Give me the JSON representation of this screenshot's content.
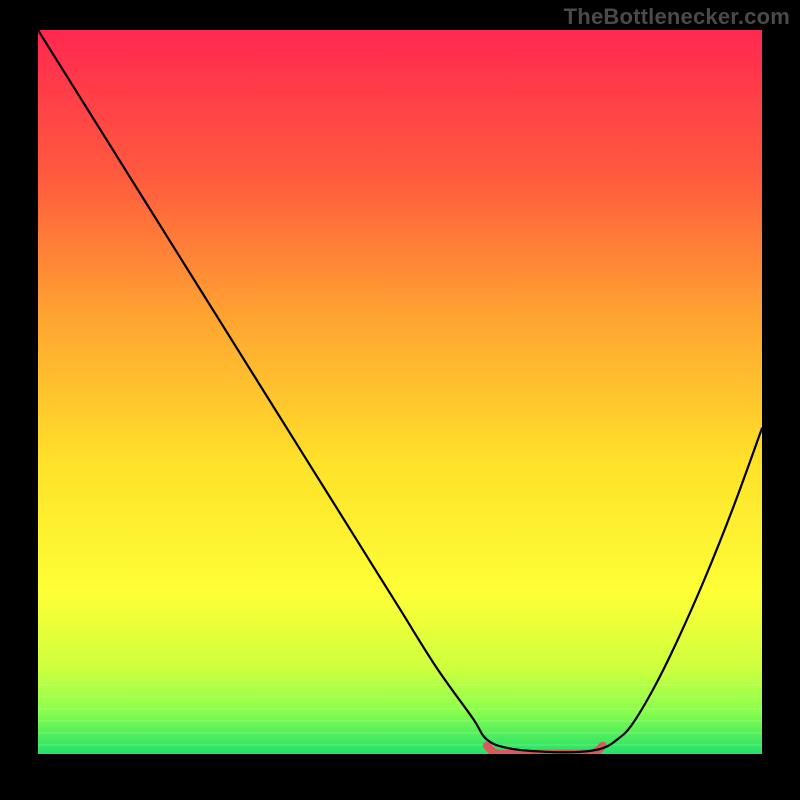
{
  "watermark": "TheBottleneсker.com",
  "chart_data": {
    "type": "line",
    "title": "",
    "xlabel": "",
    "ylabel": "",
    "xlim": [
      0,
      100
    ],
    "ylim": [
      0,
      100
    ],
    "axes_visible": false,
    "grid": false,
    "background": {
      "type": "vertical-gradient",
      "stops": [
        {
          "offset": 0.0,
          "color": "#ff2850"
        },
        {
          "offset": 0.2,
          "color": "#ff5a3e"
        },
        {
          "offset": 0.4,
          "color": "#ffa531"
        },
        {
          "offset": 0.6,
          "color": "#ffe22a"
        },
        {
          "offset": 0.78,
          "color": "#fdff36"
        },
        {
          "offset": 0.88,
          "color": "#cfff3e"
        },
        {
          "offset": 0.94,
          "color": "#8bff4d"
        },
        {
          "offset": 1.0,
          "color": "#23e06a"
        }
      ]
    },
    "series": [
      {
        "name": "bottleneck-curve",
        "stroke": "#000000",
        "stroke_width": 2.2,
        "x": [
          0,
          5,
          10,
          15,
          20,
          25,
          30,
          35,
          40,
          45,
          50,
          55,
          60,
          62,
          65,
          70,
          75,
          78,
          80,
          82,
          85,
          88,
          92,
          96,
          100
        ],
        "values": [
          100,
          92,
          84,
          76,
          68,
          60,
          52,
          44,
          36,
          28,
          20,
          12,
          5,
          2,
          0.8,
          0.3,
          0.3,
          0.8,
          2,
          4,
          9,
          15,
          24,
          34,
          45
        ]
      }
    ],
    "flat_region": {
      "stroke": "#d85a5a",
      "stroke_width": 8,
      "x_start": 62,
      "x_end": 78,
      "y": 0.6
    }
  }
}
